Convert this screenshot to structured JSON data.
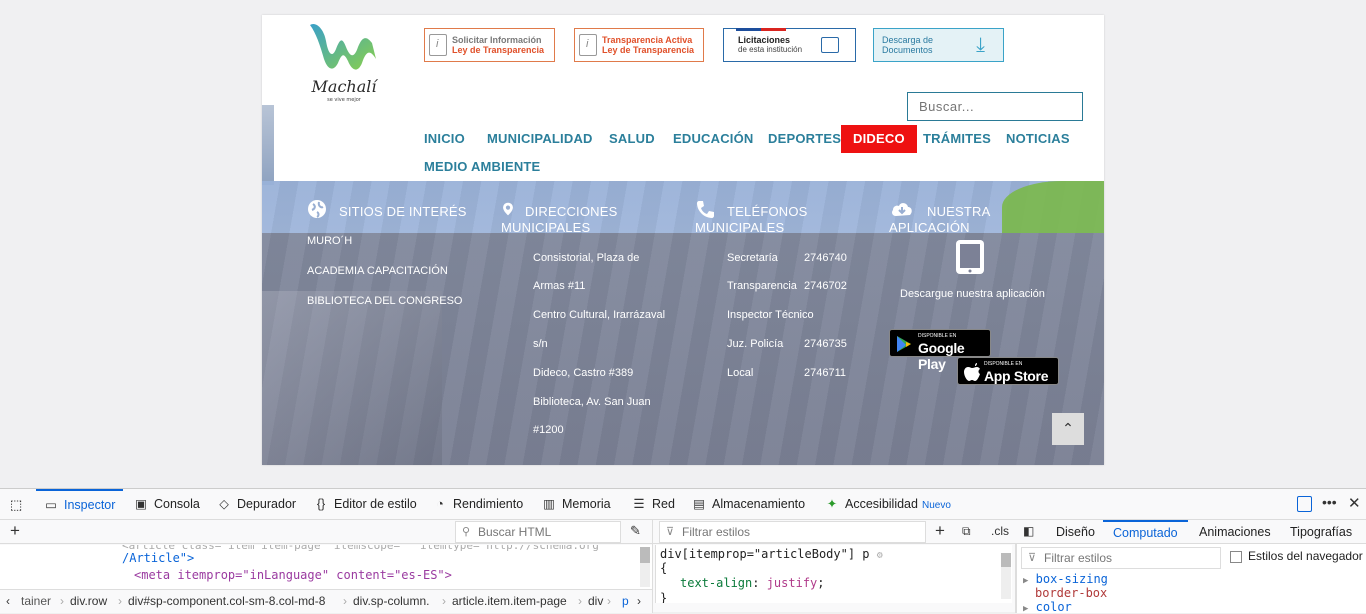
{
  "site": {
    "logo": {
      "name": "Machalí",
      "tagline": "se vive mejor"
    },
    "banners": [
      {
        "line1": "Solicitar Información",
        "line2": "Ley de Transparencia"
      },
      {
        "line1": "Transparencia Activa",
        "line2": "Ley de Transparencia"
      },
      {
        "line1": "Licitaciones",
        "line2": "de esta institución"
      },
      {
        "line1": "Descarga de",
        "line2": "Documentos"
      }
    ],
    "search_placeholder": "Buscar...",
    "nav": [
      "INICIO",
      "MUNICIPALIDAD",
      "SALUD",
      "EDUCACIÓN",
      "DEPORTES",
      "DIDECO",
      "TRÁMITES",
      "NOTICIAS",
      "MEDIO AMBIENTE"
    ],
    "nav_active": "DIDECO",
    "footer": {
      "headings": {
        "sitios": "SITIOS DE INTERÉS",
        "direcciones_1": "DIRECCIONES",
        "direcciones_2": "MUNICIPALES",
        "telefonos_1": "TELÉFONOS",
        "telefonos_2": "MUNICIPALES",
        "app_1": "NUESTRA",
        "app_2": "APLICACIÓN"
      },
      "sitios": [
        "MURO´H",
        "ACADEMIA CAPACITACIÓN",
        "BIBLIOTECA DEL CONGRESO"
      ],
      "direcciones": [
        "Consistorial, Plaza de",
        "Armas #11",
        "Centro Cultural, Irarrázaval",
        "s/n",
        "Dideco, Castro #389",
        "Biblioteca, Av. San Juan",
        "#1200"
      ],
      "telefonos": [
        {
          "label": "Secretaría",
          "number": "2746740"
        },
        {
          "label": "Transparencia",
          "number": "2746702"
        },
        {
          "label": "Inspector Técnico",
          "number": ""
        },
        {
          "label": "Juz. Policía",
          "number": "2746735"
        },
        {
          "label": "Local",
          "number": "2746711"
        }
      ],
      "app_text": "Descargue nuestra aplicación",
      "google_play": {
        "small": "DISPONIBLE EN",
        "large": "Google Play"
      },
      "app_store": {
        "small": "DISPONIBLE EN",
        "large": "App Store"
      }
    }
  },
  "devtools": {
    "tabs": [
      "Inspector",
      "Consola",
      "Depurador",
      "Editor de estilo",
      "Rendimiento",
      "Memoria",
      "Red",
      "Almacenamiento",
      "Accesibilidad"
    ],
    "new_badge": "Nuevo",
    "search_html": "Buscar HTML",
    "filter_styles": "Filtrar estilos",
    "cls": ".cls",
    "html_lines": [
      "/Article\">",
      "<meta itemprop=\"inLanguage\" content=\"es-ES\">"
    ],
    "css_rule": {
      "selector": "div[itemprop=\"articleBody\"] p",
      "open": "{",
      "property": "text-align",
      "value": "justify",
      "close": "}"
    },
    "right_tabs": [
      "Diseño",
      "Computado",
      "Animaciones",
      "Tipografías"
    ],
    "computed_filter": "Filtrar estilos",
    "browser_styles": "Estilos del navegador",
    "computed": [
      {
        "prop": "box-sizing",
        "value": "border-box"
      },
      {
        "prop": "color",
        "value": ""
      }
    ],
    "breadcrumbs": [
      "tainer",
      "div.row",
      "div#sp-component.col-sm-8.col-md-8",
      "div.sp-column.",
      "article.item.item-page",
      "div",
      "p"
    ]
  }
}
